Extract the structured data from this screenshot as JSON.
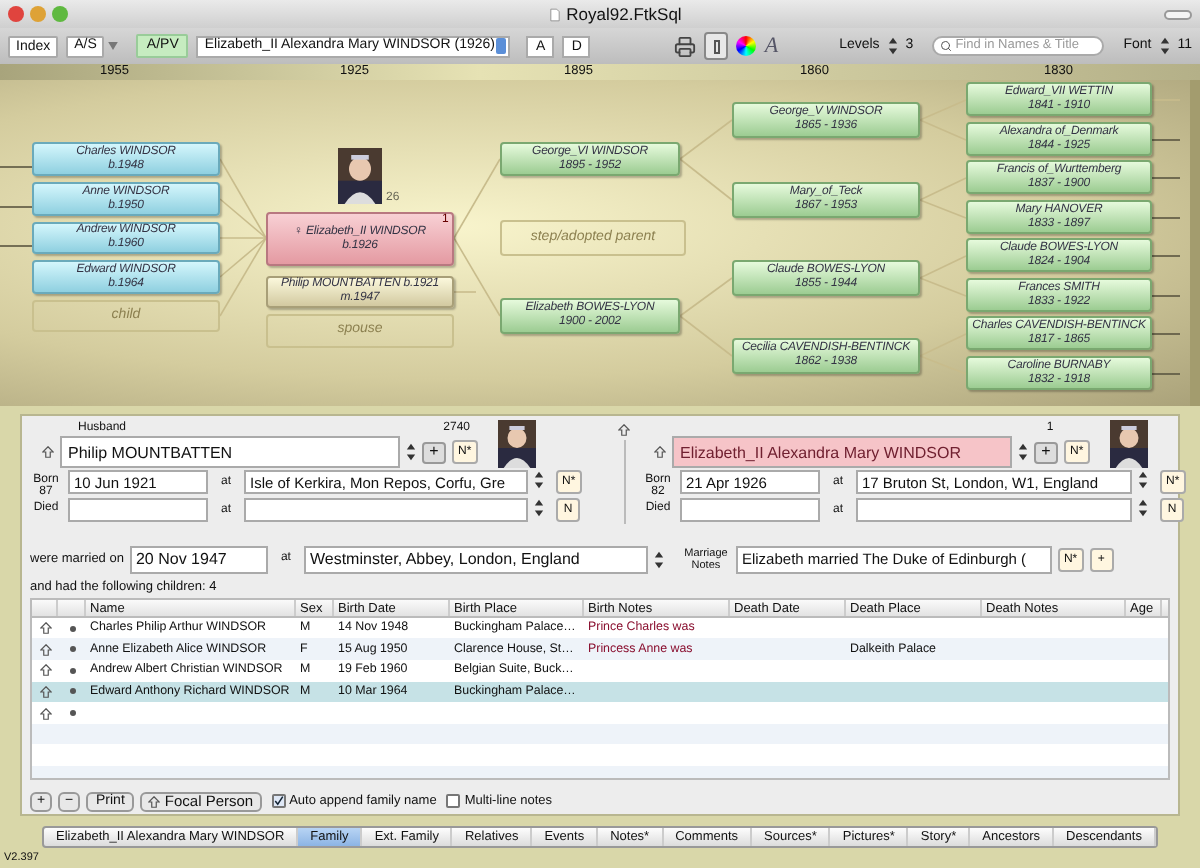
{
  "window": {
    "title": "Royal92.FtkSql"
  },
  "toolbar": {
    "index_button": "Index",
    "as_button": "A/S",
    "apv_button": {
      "label": "A/PV",
      "selected": true
    },
    "person_select": "Elizabeth_II Alexandra Mary WINDSOR (1926)",
    "a_button": "A",
    "d_button": "D",
    "font_glyph": "A",
    "levels_label": "Levels",
    "levels_value": "3",
    "search": {
      "placeholder": "Find in Names & Title"
    },
    "font_label": "Font",
    "font_value": "11"
  },
  "chart": {
    "years": [
      "1955",
      "1925",
      "1895",
      "1860",
      "1830"
    ],
    "children": [
      {
        "name": "Charles WINDSOR",
        "dates": "b.1948"
      },
      {
        "name": "Anne WINDSOR",
        "dates": "b.1950"
      },
      {
        "name": "Andrew WINDSOR",
        "dates": "b.1960"
      },
      {
        "name": "Edward WINDSOR",
        "dates": "b.1964"
      }
    ],
    "child_placeholder": "child",
    "focus": {
      "name": "♀ Elizabeth_II WINDSOR",
      "dates": "b.1926",
      "badge": "1",
      "age": "26"
    },
    "spouse": {
      "name": "Philip MOUNTBATTEN b.1921",
      "dates": "m.1947"
    },
    "spouse_placeholder": "spouse",
    "step_placeholder": "step/adopted parent",
    "parents": [
      {
        "name": "George_VI WINDSOR",
        "dates": "1895 - 1952"
      },
      {
        "name": "Elizabeth BOWES-LYON",
        "dates": "1900 - 2002"
      }
    ],
    "grandparents": [
      {
        "name": "George_V WINDSOR",
        "dates": "1865 - 1936"
      },
      {
        "name": "Mary_of_Teck",
        "dates": "1867 - 1953"
      },
      {
        "name": "Claude BOWES-LYON",
        "dates": "1855 - 1944"
      },
      {
        "name": "Cecilia CAVENDISH-BENTINCK",
        "dates": "1862 - 1938"
      }
    ],
    "great_grandparents": [
      {
        "name": "Edward_VII WETTIN",
        "dates": "1841 - 1910"
      },
      {
        "name": "Alexandra of_Denmark",
        "dates": "1844 - 1925"
      },
      {
        "name": "Francis of_Wurttemberg",
        "dates": "1837 - 1900"
      },
      {
        "name": "Mary HANOVER",
        "dates": "1833 - 1897"
      },
      {
        "name": "Claude BOWES-LYON",
        "dates": "1824 - 1904"
      },
      {
        "name": "Frances SMITH",
        "dates": "1833 - 1922"
      },
      {
        "name": "Charles CAVENDISH-BENTINCK",
        "dates": "1817 - 1865"
      },
      {
        "name": "Caroline BURNABY",
        "dates": "1832 - 1918"
      }
    ]
  },
  "family": {
    "husband": {
      "role_label": "Husband",
      "number": "2740",
      "name": "Philip MOUNTBATTEN",
      "focus": false,
      "add_button": "+",
      "note_button": "N*",
      "born_label": "Born",
      "age": "87",
      "birth_date": "10 Jun 1921",
      "at_label": "at",
      "birth_place": "Isle of Kerkira, Mon Repos, Corfu, Gre",
      "birth_note_button": "N*",
      "died_label": "Died",
      "death_at_label": "at",
      "death_note_button": "N"
    },
    "wife": {
      "number": "1",
      "name": "Elizabeth_II Alexandra Mary WINDSOR",
      "focus": true,
      "add_button": "+",
      "note_button": "N*",
      "born_label": "Born",
      "age": "82",
      "birth_date": "21 Apr 1926",
      "at_label": "at",
      "birth_place": "17 Bruton St, London, W1, England",
      "birth_note_button": "N*",
      "died_label": "Died",
      "death_at_label": "at",
      "death_note_button": "N"
    },
    "marriage": {
      "label": "were married on",
      "date": "20 Nov 1947",
      "at_label": "at",
      "place": "Westminster, Abbey, London, England",
      "notes_label": "Marriage Notes",
      "notes": "Elizabeth married The Duke of Edinburgh (",
      "note_button": "N*",
      "add_button": "+"
    },
    "children_summary": "and had the following children: 4"
  },
  "table": {
    "columns": [
      "Name",
      "Sex",
      "Birth Date",
      "Birth Place",
      "Birth Notes",
      "Death Date",
      "Death Place",
      "Death Notes",
      "Age"
    ],
    "rows": [
      {
        "cells": [
          "Charles Philip Arthur WINDSOR",
          "M",
          "14 Nov 1948",
          "Buckingham Palace…",
          "Prince Charles was",
          "",
          "",
          "",
          ""
        ],
        "selected": false
      },
      {
        "cells": [
          "Anne Elizabeth Alice WINDSOR",
          "F",
          "15 Aug 1950",
          "Clarence House, St…",
          "Princess Anne was",
          "",
          "Dalkeith Palace",
          "",
          ""
        ],
        "selected": false
      },
      {
        "cells": [
          "Andrew Albert Christian WINDSOR",
          "M",
          "19 Feb 1960",
          "Belgian Suite, Buck…",
          "",
          "",
          "",
          "",
          ""
        ],
        "selected": false
      },
      {
        "cells": [
          "Edward Anthony Richard WINDSOR",
          "M",
          "10 Mar 1964",
          "Buckingham Palace…",
          "",
          "",
          "",
          "",
          ""
        ],
        "selected": true
      }
    ]
  },
  "actions": {
    "add_button": "+",
    "remove_button": "−",
    "print_button": "Print",
    "focal_button": "Focal Person",
    "auto_append": {
      "label": "Auto append family name",
      "checked": true
    },
    "multi_line": {
      "label": "Multi-line notes",
      "checked": false
    }
  },
  "tabs": [
    {
      "label": "Elizabeth_II Alexandra Mary WINDSOR",
      "selected": false
    },
    {
      "label": "Family",
      "selected": true
    },
    {
      "label": "Ext. Family",
      "selected": false
    },
    {
      "label": "Relatives",
      "selected": false
    },
    {
      "label": "Events",
      "selected": false
    },
    {
      "label": "Notes*",
      "selected": false
    },
    {
      "label": "Comments",
      "selected": false
    },
    {
      "label": "Sources*",
      "selected": false
    },
    {
      "label": "Pictures*",
      "selected": false
    },
    {
      "label": "Story*",
      "selected": false
    },
    {
      "label": "Ancestors",
      "selected": false
    },
    {
      "label": "Descendants",
      "selected": false
    }
  ],
  "version": "V2.397"
}
